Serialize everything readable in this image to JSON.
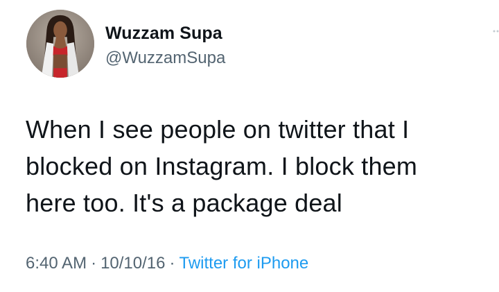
{
  "author": {
    "display_name": "Wuzzam Supa",
    "handle": "@WuzzamSupa",
    "avatar_icon": "profile-photo"
  },
  "tweet": {
    "text_lines": [
      "When I see people on twitter that I",
      "blocked on Instagram. I block them",
      "here too. It's a package deal"
    ]
  },
  "meta": {
    "time": "6:40 AM",
    "separator": "·",
    "date": "10/10/16",
    "source": "Twitter for iPhone"
  },
  "colors": {
    "text": "#0f1419",
    "secondary": "#536471",
    "link": "#1d9bf0"
  }
}
